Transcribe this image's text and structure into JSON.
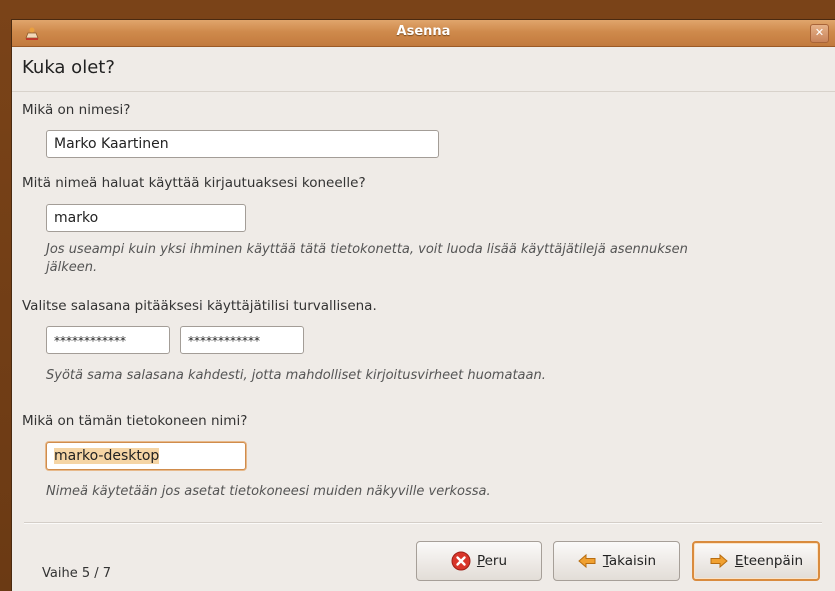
{
  "window": {
    "title": "Asenna",
    "close_label": "✕"
  },
  "page": {
    "title": "Kuka olet?"
  },
  "name_section": {
    "label": "Mikä on nimesi?",
    "value": "Marko Kaartinen"
  },
  "login_section": {
    "label": "Mitä nimeä haluat käyttää kirjautuaksesi koneelle?",
    "value": "marko",
    "hint_line1": "Jos useampi kuin yksi ihminen käyttää tätä tietokonetta, voit luoda lisää käyttäjätilejä asennuksen",
    "hint_line2": "jälkeen."
  },
  "password_section": {
    "label": "Valitse salasana pitääksesi käyttäjätilisi turvallisena.",
    "password": "************",
    "confirm": "************",
    "hint": "Syötä sama salasana kahdesti, jotta mahdolliset kirjoitusvirheet huomataan."
  },
  "hostname_section": {
    "label": "Mikä on tämän tietokoneen nimi?",
    "value": "marko-desktop",
    "hint": "Nimeä käytetään jos asetat tietokoneesi muiden näkyville verkossa."
  },
  "footer": {
    "step": "Vaihe 5 / 7",
    "cancel": {
      "mnemonic": "P",
      "rest": "eru",
      "icon": "cancel-icon"
    },
    "back": {
      "mnemonic": "T",
      "rest": "akaisin",
      "icon": "arrow-left-icon"
    },
    "forward": {
      "mnemonic": "E",
      "rest": "teenpäin",
      "icon": "arrow-right-icon"
    }
  }
}
